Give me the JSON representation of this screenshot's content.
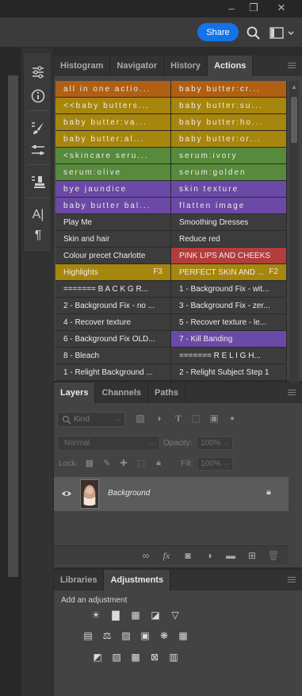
{
  "window": {
    "minimize_icon": "minimize-icon",
    "restore_icon": "restore-icon",
    "close_icon": "close-icon",
    "share_label": "Share"
  },
  "actions_panel": {
    "tabs": [
      {
        "label": "Histogram",
        "active": false
      },
      {
        "label": "Navigator",
        "active": false
      },
      {
        "label": "History",
        "active": false
      },
      {
        "label": "Actions",
        "active": true
      }
    ],
    "actions": [
      {
        "label": "all in one actio...",
        "color": "#b05f13",
        "spaced": true,
        "key": ""
      },
      {
        "label": "baby butter:cr...",
        "color": "#b05f13",
        "spaced": true,
        "key": ""
      },
      {
        "label": "<<baby butters...",
        "color": "#a7860d",
        "spaced": true,
        "key": ""
      },
      {
        "label": "baby butter:su...",
        "color": "#a7860d",
        "spaced": true,
        "key": ""
      },
      {
        "label": "baby butter:va...",
        "color": "#a7860d",
        "spaced": true,
        "key": ""
      },
      {
        "label": "baby butter:ho...",
        "color": "#a7860d",
        "spaced": true,
        "key": ""
      },
      {
        "label": "baby butter:al...",
        "color": "#a7860d",
        "spaced": true,
        "key": ""
      },
      {
        "label": "baby butter:or...",
        "color": "#a7860d",
        "spaced": true,
        "key": ""
      },
      {
        "label": "<skincare seru...",
        "color": "#578a3b",
        "spaced": true,
        "key": ""
      },
      {
        "label": "serum:ivory",
        "color": "#578a3b",
        "spaced": true,
        "key": ""
      },
      {
        "label": "serum:olive",
        "color": "#578a3b",
        "spaced": true,
        "key": ""
      },
      {
        "label": "serum:golden",
        "color": "#578a3b",
        "spaced": true,
        "key": ""
      },
      {
        "label": "bye jaundice",
        "color": "#6b49a6",
        "spaced": true,
        "key": ""
      },
      {
        "label": "skin texture",
        "color": "#6b49a6",
        "spaced": true,
        "key": ""
      },
      {
        "label": "baby butter bal...",
        "color": "#6b49a6",
        "spaced": true,
        "key": ""
      },
      {
        "label": "flatten image",
        "color": "#6b49a6",
        "spaced": true,
        "key": ""
      },
      {
        "label": "Play Me",
        "color": "#3c3c3c",
        "spaced": false,
        "key": ""
      },
      {
        "label": "Smoothing Dresses",
        "color": "#3c3c3c",
        "spaced": false,
        "key": ""
      },
      {
        "label": "Skin and hair",
        "color": "#3c3c3c",
        "spaced": false,
        "key": ""
      },
      {
        "label": "Reduce red",
        "color": "#3c3c3c",
        "spaced": false,
        "key": ""
      },
      {
        "label": "Colour precet Charlotte",
        "color": "#3c3c3c",
        "spaced": false,
        "key": ""
      },
      {
        "label": "PINK LIPS AND CHEEKS",
        "color": "#b33c3c",
        "spaced": false,
        "key": ""
      },
      {
        "label": "Highlights",
        "color": "#a7860d",
        "spaced": false,
        "key": "F3"
      },
      {
        "label": "PERFECT SKIN AND ...",
        "color": "#a7860d",
        "spaced": false,
        "key": "F2"
      },
      {
        "label": "======= B A C K G R...",
        "color": "#3c3c3c",
        "spaced": false,
        "key": ""
      },
      {
        "label": "1 - Background Fix - wit...",
        "color": "#3c3c3c",
        "spaced": false,
        "key": ""
      },
      {
        "label": "2 - Background Fix - no ...",
        "color": "#3c3c3c",
        "spaced": false,
        "key": ""
      },
      {
        "label": "3 - Background Fix - zer...",
        "color": "#3c3c3c",
        "spaced": false,
        "key": ""
      },
      {
        "label": "4 - Recover texture",
        "color": "#3c3c3c",
        "spaced": false,
        "key": ""
      },
      {
        "label": "5 - Recover texture - le...",
        "color": "#3c3c3c",
        "spaced": false,
        "key": ""
      },
      {
        "label": "6 - Background Fix OLD...",
        "color": "#3c3c3c",
        "spaced": false,
        "key": ""
      },
      {
        "label": "7 - Kill Banding",
        "color": "#6b49a6",
        "spaced": false,
        "key": ""
      },
      {
        "label": "8 - Bleach",
        "color": "#3c3c3c",
        "spaced": false,
        "key": ""
      },
      {
        "label": "======= R E L I G H...",
        "color": "#3c3c3c",
        "spaced": false,
        "key": ""
      },
      {
        "label": "1 - Relight Background ...",
        "color": "#3c3c3c",
        "spaced": false,
        "key": ""
      },
      {
        "label": "2 - Relight Subject Step 1",
        "color": "#3c3c3c",
        "spaced": false,
        "key": ""
      }
    ]
  },
  "layers_panel": {
    "tabs": [
      {
        "label": "Layers",
        "active": true
      },
      {
        "label": "Channels",
        "active": false
      },
      {
        "label": "Paths",
        "active": false
      }
    ],
    "filter_placeholder": "Kind",
    "blend_mode": "Normal",
    "opacity_label": "Opacity:",
    "opacity_value": "100%",
    "lock_label": "Lock:",
    "fill_label": "Fill:",
    "fill_value": "100%",
    "layers": [
      {
        "name": "Background",
        "visible": true,
        "locked": true
      }
    ]
  },
  "adjustments_panel": {
    "tabs": [
      {
        "label": "Libraries",
        "active": false
      },
      {
        "label": "Adjustments",
        "active": true
      }
    ],
    "heading": "Add an adjustment"
  }
}
